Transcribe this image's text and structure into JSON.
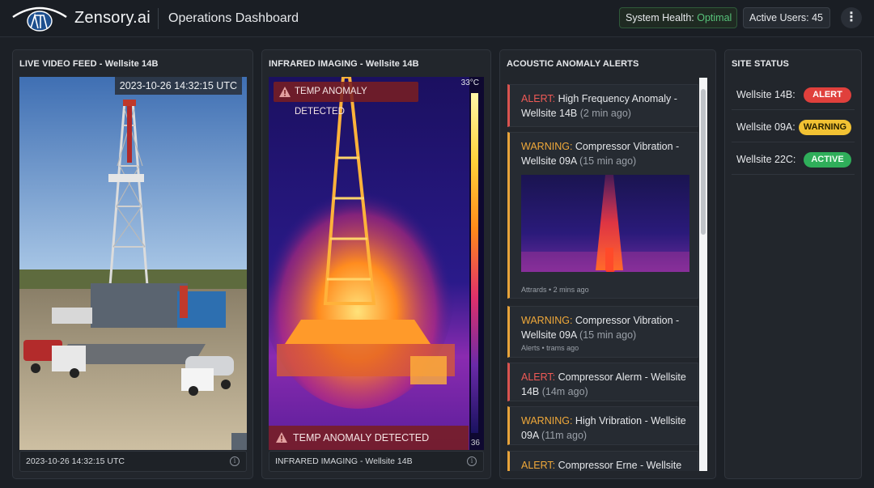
{
  "header": {
    "brand": "Zensory.ai",
    "title": "Operations Dashboard",
    "health_label": "System Health:",
    "health_value": "Optimal",
    "users": "Active Users: 45",
    "menu_glyph": "⋮"
  },
  "video": {
    "title": "LIVE VIDEO FEED - Wellsite 14B",
    "timestamp_overlay": "2023-10-26 14:32:15 UTC",
    "caption": "2023-10-26 14:32:15 UTC",
    "info_glyph": "i"
  },
  "ir": {
    "title": "INFRARED IMAGING - Wellsite 14B",
    "badge_top": "TEMP ANOMALY DETECTED",
    "badge_bottom": "TEMP ANOMALY DETECTED",
    "scale_max": "33°C",
    "scale_min": "36",
    "caption": "INFRARED IMAGING - Wellsite 14B",
    "info_glyph": "i"
  },
  "acoustic": {
    "title": "ACOUSTIC ANOMALY ALERTS",
    "alerts": [
      {
        "level": "ALERT:",
        "text": " High Frequency Anomaly - Wellsite 14B ",
        "time": "(2 min ago)",
        "meta": ""
      },
      {
        "level": "WARNING:",
        "text": " Compressor Vibration - Wellsite 09A ",
        "time": "(15 min ago)",
        "meta": "Attrards • 2 mins ago"
      },
      {
        "level": "WARNING:",
        "text": " Compressor Vibration - Wellsite 09A ",
        "time": "(15 min ago)",
        "meta": "Alerts • trams ago"
      },
      {
        "level": "ALERT:",
        "text": " Compressor Alerm - Wellsite 14B ",
        "time": "(14m ago)",
        "meta": ""
      },
      {
        "level": "WARNING:",
        "text": " High Vribration - Wellsite 09A ",
        "time": "(11m ago)",
        "meta": ""
      },
      {
        "level": "ALERT:",
        "text": " Compressor Erne - Wellsite",
        "time": "",
        "meta": ""
      }
    ]
  },
  "sites": {
    "title": "SITE STATUS",
    "rows": [
      {
        "label": "Wellsite 14B:",
        "status": "ALERT"
      },
      {
        "label": "Wellsite 09A:",
        "status": "WARNING"
      },
      {
        "label": "Wellsite 22C:",
        "status": "ACTIVE"
      }
    ]
  },
  "colors": {
    "alert": "#e0403c",
    "warning": "#f2c233",
    "active": "#2fae5a",
    "health_ok": "#57c27a"
  },
  "icons": [
    "oil-derrick-logo-icon",
    "kebab-menu-icon",
    "info-icon",
    "warning-triangle-icon"
  ]
}
